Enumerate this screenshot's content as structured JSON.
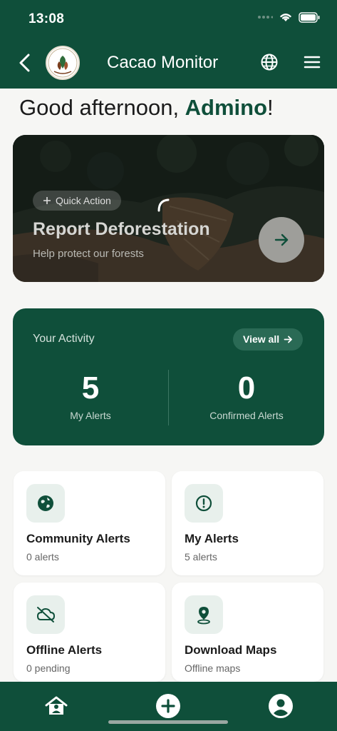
{
  "status_bar": {
    "time": "13:08"
  },
  "header": {
    "title": "Cacao Monitor",
    "logo_text": "COCOA TRUST"
  },
  "greeting": {
    "prefix": "Good afternoon, ",
    "name": "Admino",
    "suffix": "!"
  },
  "hero": {
    "chip_label": "Quick Action",
    "title": "Report Deforestation",
    "subtitle": "Help protect our forests"
  },
  "activity": {
    "label": "Your Activity",
    "view_all": "View all",
    "stats": [
      {
        "value": "5",
        "label": "My Alerts"
      },
      {
        "value": "0",
        "label": "Confirmed Alerts"
      }
    ]
  },
  "tiles": [
    {
      "title": "Community Alerts",
      "subtitle": "0 alerts",
      "icon": "globe-icon"
    },
    {
      "title": "My Alerts",
      "subtitle": "5 alerts",
      "icon": "alert-circle-icon"
    },
    {
      "title": "Offline Alerts",
      "subtitle": "0 pending",
      "icon": "cloud-off-icon"
    },
    {
      "title": "Download Maps",
      "subtitle": "Offline maps",
      "icon": "map-pin-icon"
    }
  ],
  "colors": {
    "primary": "#0f4f3a",
    "background": "#f6f6f4",
    "tile_icon_bg": "#e8f0ec"
  }
}
